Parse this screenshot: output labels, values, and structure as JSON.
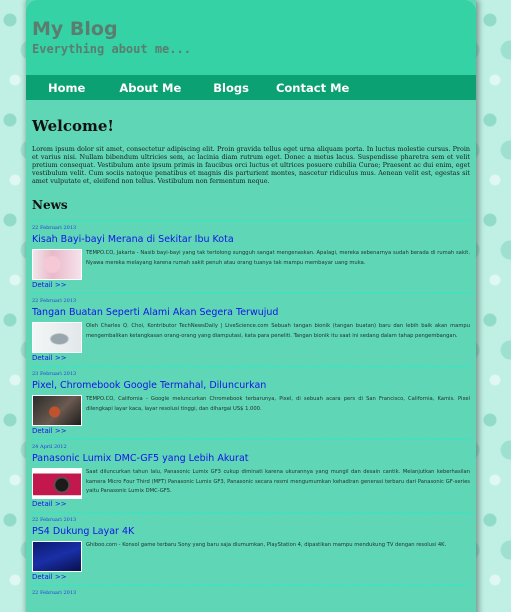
{
  "header": {
    "title": "My Blog",
    "subtitle": "Everything about me..."
  },
  "nav": {
    "items": [
      {
        "label": "Home"
      },
      {
        "label": "About Me"
      },
      {
        "label": "Blogs"
      },
      {
        "label": "Contact Me"
      }
    ]
  },
  "welcome": {
    "title": "Welcome!",
    "text": "Lorem ipsum dolor sit amet, consectetur adipiscing elit. Proin gravida tellus eget urna aliquam porta. In luctus molestie cursus. Proin et varius nisi. Nullam bibendum ultricies sem, ac lacinia diam rutrum eget. Donec a metus lacus. Suspendisse pharetra sem et velit pretium consequat. Vestibulum ante ipsum primis in faucibus orci luctus et ultrices posuere cubilia Curae; Praesent ac dui enim, eget vestibulum velit. Cum sociis natoque penatibus et magnis dis parturient montes, nascetur ridiculus mus. Aenean velit est, egestas sit amet vulputate et, eleifend non tellus. Vestibulum non fermentum neque."
  },
  "news": {
    "title": "News",
    "items": [
      {
        "date": "22 Februari 2013",
        "title": "Kisah Bayi-bayi Merana di Sekitar Ibu Kota",
        "excerpt": "TEMPO.CO, Jakarta - Nasib bayi-bayi yang tak tertolong sungguh sangat mengenaskan. Apalagi, mereka sebenarnya sudah berada di rumah sakit. Nyawa mereka melayang karena rumah sakit penuh atau orang tuanya tak mampu membayar uang muka.",
        "detail": "Detail >>"
      },
      {
        "date": "22 Februari 2013",
        "title": "Tangan Buatan Seperti Alami Akan Segera Terwujud",
        "excerpt": "Oleh Charles Q. Choi, Kontributor TechNewsDaily | LiveScience.com Sebuah tangan bionik (tangan buatan) baru dan lebih baik akan mampu mengembalikan ketangkasan orang-orang yang diamputasi, kata para peneliti. Tangan bionik itu saat ini sedang dalam tahap pengembangan.",
        "detail": "Detail >>"
      },
      {
        "date": "23 Februari 2013",
        "title": "Pixel, Chromebook Google Termahal, Diluncurkan",
        "excerpt": "TEMPO.CO, California - Google meluncurkan Chromebook terbarunya, Pixel, di sebuah acara pers di San Francisco, California, Kamis. Pixel dilengkapi layar kaca, layar resolusi tinggi, dan dihargai US$ 1.000.",
        "detail": "Detail >>"
      },
      {
        "date": "24 April 2012",
        "title": "Panasonic Lumix DMC-GF5 yang Lebih Akurat",
        "excerpt": "Saat diluncurkan tahun lalu, Panasonic Lumix GF3 cukup diminati karena ukurannya yang mungil dan desain cantik. Melanjutkan keberhasilan kamera Micro Four Third (MFT) Panasonic Lumix GF3, Panasonic secara resmi mengumumkan kehadiran generasi terbaru dari Panasonic GF-series yaitu Panasonic Lumix DMC-GF5.",
        "detail": "Detail >>"
      },
      {
        "date": "22 Februari 2013",
        "title": "PS4 Dukung Layar 4K",
        "excerpt": "Ghiboo.com - Konsol game terbaru Sony yang baru saja diumumkan, PlayStation 4, dipastikan mampu mendukung TV dengan resolusi 4K.",
        "detail": "Detail >>"
      },
      {
        "date": "22 Februari 2013",
        "title": "",
        "excerpt": "",
        "detail": ""
      }
    ]
  },
  "colors": {
    "header": "#35d2a6",
    "nav": "#0ca172",
    "content": "#5fd6b6",
    "link": "#1414e6",
    "separator": "#18f1cd"
  },
  "icons": [
    "double-chevron-right-icon"
  ]
}
